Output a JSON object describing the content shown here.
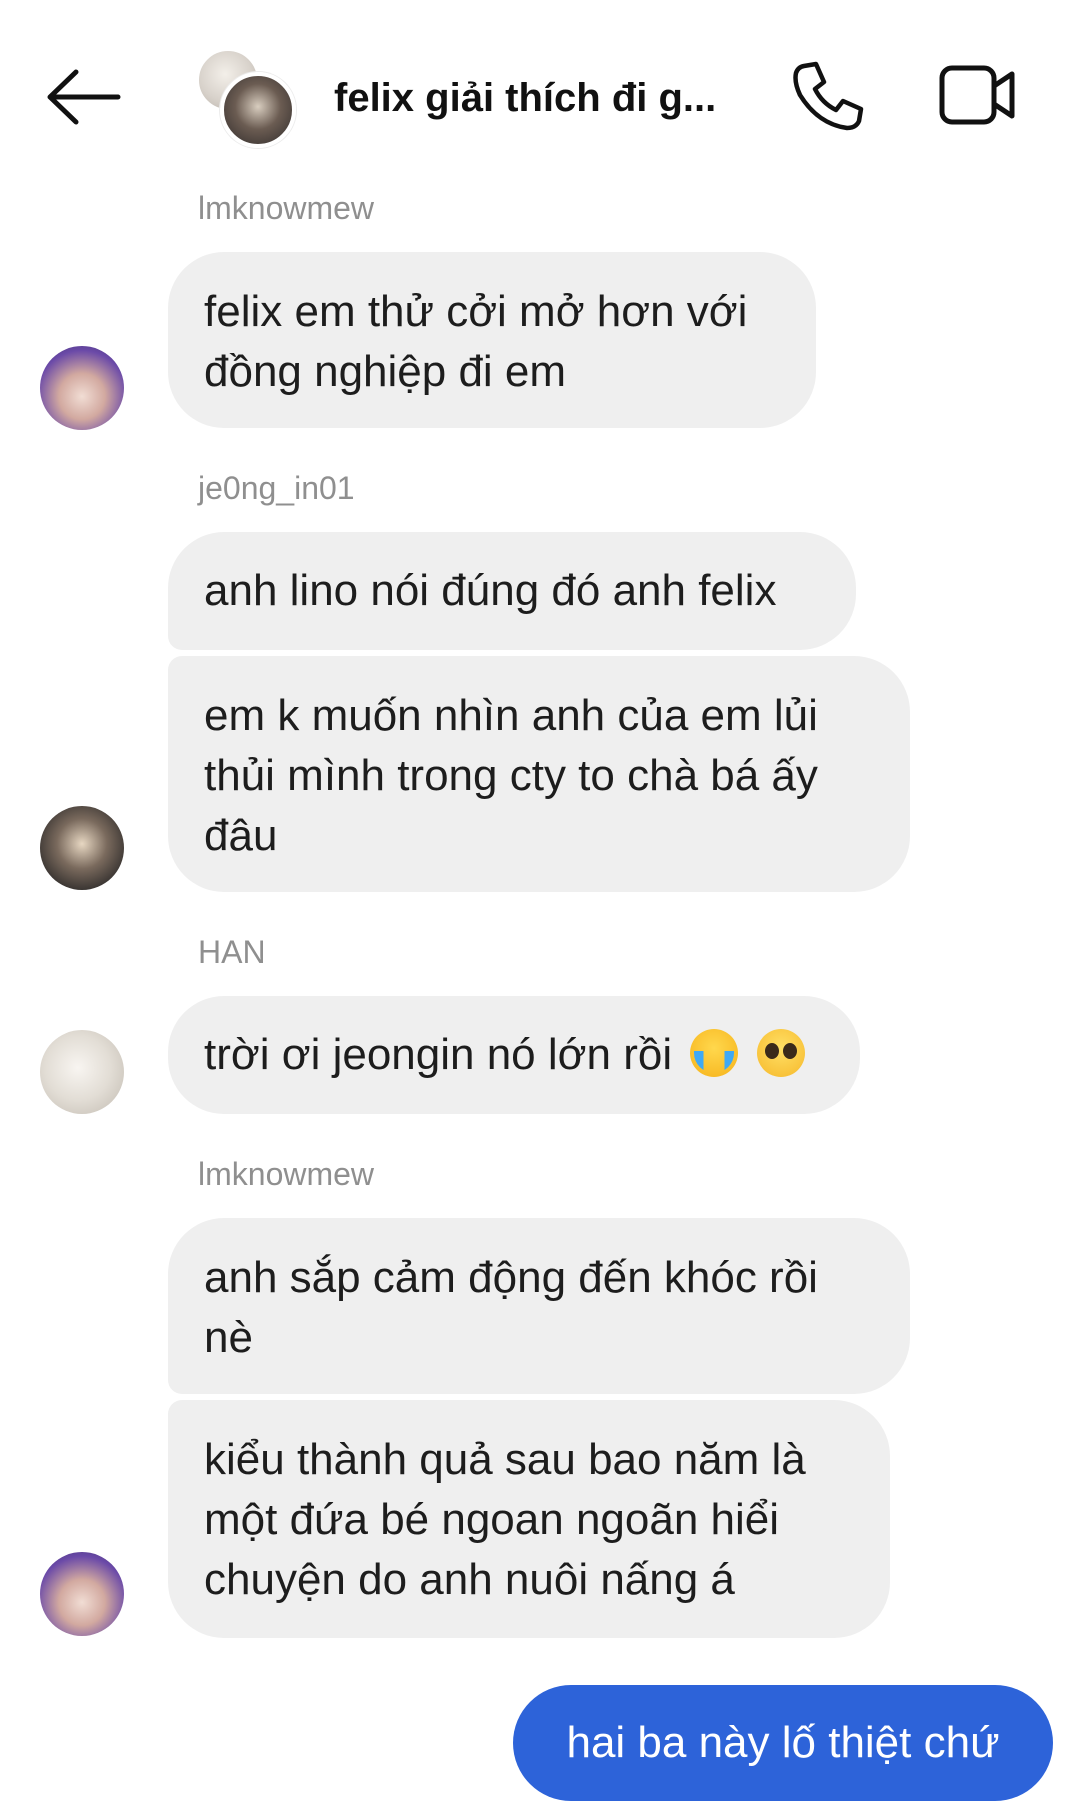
{
  "header": {
    "title": "felix giải thích đi g...",
    "back_icon": "arrow-left-icon",
    "call_icon": "phone-icon",
    "video_icon": "video-camera-icon"
  },
  "messages": [
    {
      "sender": "lmknowmew",
      "lines": [
        "felix em thử cởi mở hơn với",
        "đồng nghiệp đi em"
      ]
    },
    {
      "sender": "je0ng_in01",
      "bubbles": [
        "anh lino nói đúng đó anh felix",
        [
          "em k muốn nhìn anh của em lủi",
          "thủi mình trong cty to chà bá ấy",
          "đâu"
        ]
      ]
    },
    {
      "sender": "HAN",
      "text": "trời ơi jeongin nó lớn rồi",
      "emojis": [
        "loudly-crying-face",
        "pleading-face"
      ]
    },
    {
      "sender": "lmknowmew",
      "bubbles": [
        [
          "anh sắp cảm động đến khóc rồi",
          "nè"
        ],
        [
          "kiểu thành quả sau bao năm là",
          "một đứa bé ngoan ngoãn hiểi",
          "chuyện do anh nuôi nấng á"
        ]
      ]
    }
  ],
  "outgoing": {
    "text": "hai ba này lố thiệt chứ",
    "color": "#2d63d9"
  }
}
